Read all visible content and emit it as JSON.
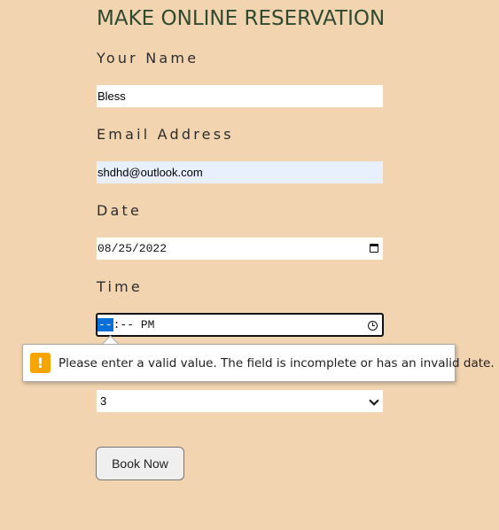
{
  "form": {
    "title": "MAKE ONLINE RESERVATION",
    "name_label": "Your Name",
    "name_value": "Bless",
    "email_label": "Email Address",
    "email_value": "shdhd@outlook.com",
    "date_label": "Date",
    "date_value": "08/25/2022",
    "time_label": "Time",
    "time_hour_segment": "--",
    "time_rest": ":-- PM",
    "guests_value": "3",
    "submit_label": "Book Now"
  },
  "validation": {
    "message": "Please enter a valid value. The field is incomplete or has an invalid date.",
    "icon_glyph": "!",
    "icon": "warning-icon",
    "icon_color": "#f5a400"
  },
  "colors": {
    "background": "#f2d4b0",
    "title": "#2f4a2f",
    "autofill": "#e8f0fe",
    "focus_segment": "#0a6fd6"
  }
}
